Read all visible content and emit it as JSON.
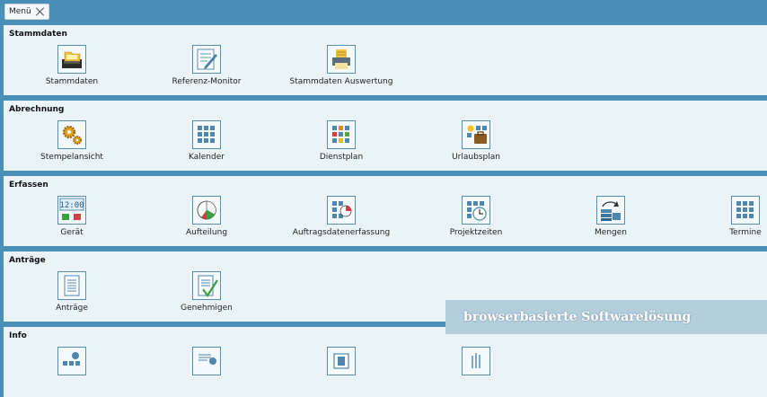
{
  "tab": {
    "label": "Menü"
  },
  "sections": {
    "stammdaten": {
      "title": "Stammdaten",
      "items": [
        {
          "label": "Stammdaten",
          "icon": "folder-drawer-icon"
        },
        {
          "label": "Referenz-Monitor",
          "icon": "notepad-pencil-icon"
        },
        {
          "label": "Stammdaten Auswertung",
          "icon": "printer-icon"
        }
      ]
    },
    "abrechnung": {
      "title": "Abrechnung",
      "items": [
        {
          "label": "Stempelansicht",
          "icon": "gears-icon"
        },
        {
          "label": "Kalender",
          "icon": "calendar-grid-icon"
        },
        {
          "label": "Dienstplan",
          "icon": "colored-grid-icon"
        },
        {
          "label": "Urlaubsplan",
          "icon": "vacation-icon"
        }
      ]
    },
    "erfassen": {
      "title": "Erfassen",
      "items": [
        {
          "label": "Gerät",
          "icon": "terminal-clock-icon",
          "clock": "12:00"
        },
        {
          "label": "Aufteilung",
          "icon": "pie-chart-icon"
        },
        {
          "label": "Auftragsdatenerfassung",
          "icon": "grid-pie-icon"
        },
        {
          "label": "Projektzeiten",
          "icon": "grid-clock-icon"
        },
        {
          "label": "Mengen",
          "icon": "stack-arrow-icon"
        },
        {
          "label": "Termine",
          "icon": "calendar-grid-icon"
        }
      ]
    },
    "antraege": {
      "title": "Anträge",
      "items": [
        {
          "label": "Anträge",
          "icon": "document-icon"
        },
        {
          "label": "Genehmigen",
          "icon": "document-check-icon"
        }
      ]
    },
    "info": {
      "title": "Info",
      "items": [
        {
          "label": "",
          "icon": "people-icon"
        },
        {
          "label": "",
          "icon": "document-person-icon"
        },
        {
          "label": "",
          "icon": "building-icon"
        },
        {
          "label": "",
          "icon": "hand-icon"
        }
      ]
    }
  },
  "banner": {
    "text": "browserbasierte Softwarelösung"
  },
  "colors": {
    "frame": "#4a8fb8",
    "section": "#eaf4f7",
    "icon_border": "#5a8fb0",
    "banner": "#b3cfdd"
  }
}
